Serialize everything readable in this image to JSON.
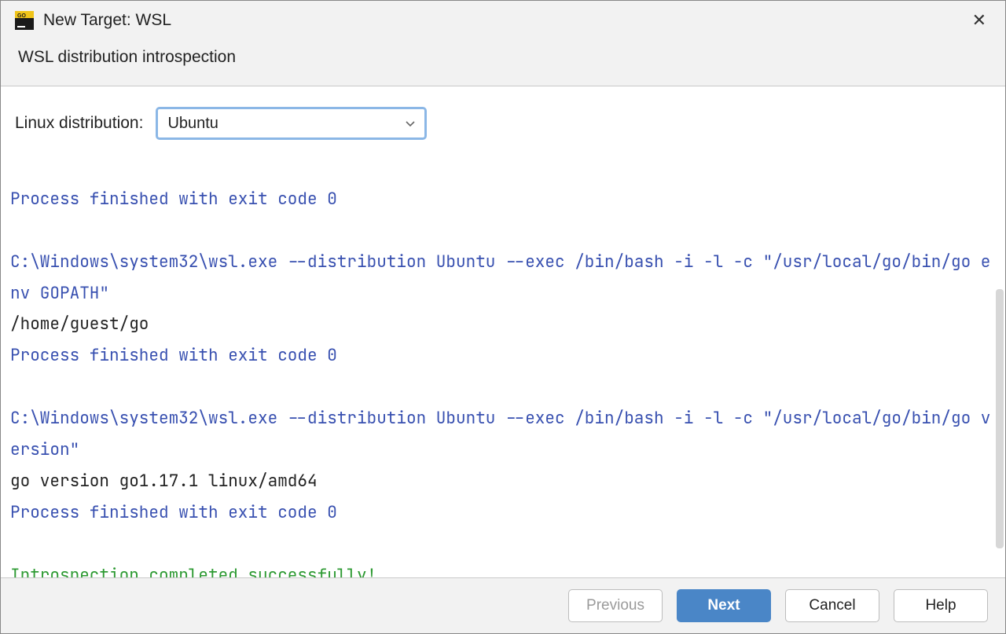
{
  "window": {
    "title": "New Target: WSL",
    "close_glyph": "✕"
  },
  "subtitle": "WSL distribution introspection",
  "form": {
    "distro_label": "Linux distribution:",
    "distro_value": "Ubuntu"
  },
  "console": {
    "line1": "Process finished with exit code 0",
    "line2": "C:\\Windows\\system32\\wsl.exe --distribution Ubuntu --exec /bin/bash -i -l -c \"/usr/local/go/bin/go env GOPATH\"",
    "line3": "/home/guest/go",
    "line4": "Process finished with exit code 0",
    "line5": "C:\\Windows\\system32\\wsl.exe --distribution Ubuntu --exec /bin/bash -i -l -c \"/usr/local/go/bin/go version\"",
    "line6": "go version go1.17.1 linux/amd64",
    "line7": "Process finished with exit code 0",
    "line8": "Introspection completed successfully!"
  },
  "buttons": {
    "previous": "Previous",
    "next": "Next",
    "cancel": "Cancel",
    "help": "Help"
  }
}
